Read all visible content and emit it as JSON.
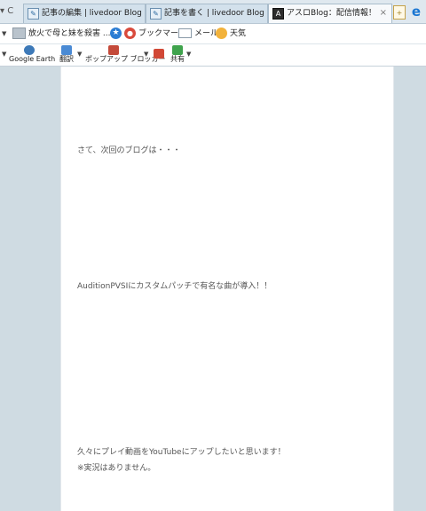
{
  "browser": {
    "nav_glyph": "▾ C",
    "tabs": [
      {
        "label": "記事の編集 | livedoor Blog",
        "icon": "blog-icon"
      },
      {
        "label": "記事を書く | livedoor Blog",
        "icon": "blog-icon"
      },
      {
        "label": "アスロBlog：配信情報！",
        "icon": "asro-icon"
      }
    ],
    "close_glyph": "×",
    "new_tab_glyph": "+",
    "ie_glyph": "e"
  },
  "favorites": {
    "item1": "放火で母と妹を殺害 ...",
    "item2": "ブックマーク",
    "item3": "メール",
    "item4": "天気"
  },
  "toolbar": {
    "google_earth": "Google Earth",
    "translate": "翻訳",
    "popup_blocker": "ポップアップ ブロッカー",
    "share": "共有"
  },
  "content": {
    "line1": "さて、次回のブログは・・・",
    "line2": "AuditionPVSIにカスタムパッチで有名な曲が導入！！",
    "line3": "久々にプレイ動画をYouTubeにアップしたいと思います！",
    "line4": "※実況はありません。"
  }
}
